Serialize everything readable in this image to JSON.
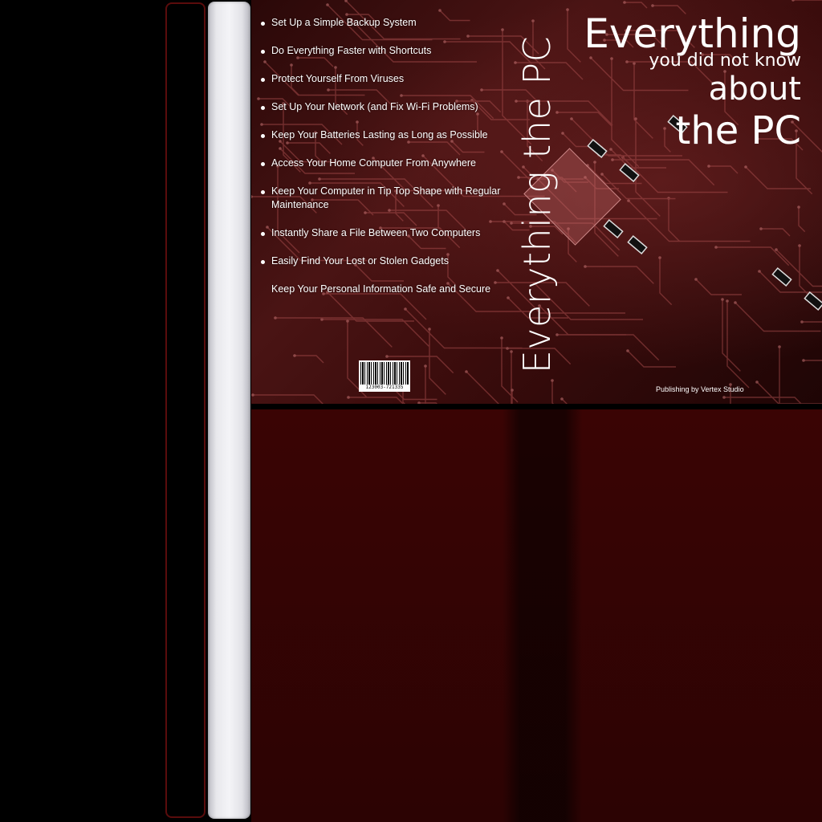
{
  "features": [
    {
      "text": "Set Up a Simple Backup System",
      "bullet": true
    },
    {
      "text": "Do Everything Faster with Shortcuts",
      "bullet": true
    },
    {
      "text": "Protect Yourself From Viruses",
      "bullet": true
    },
    {
      "text": "Set Up Your Network (and Fix Wi-Fi Problems)",
      "bullet": true
    },
    {
      "text": "Keep Your Batteries Lasting as Long as Possible",
      "bullet": true
    },
    {
      "text": "Access Your Home Computer From Anywhere",
      "bullet": true
    },
    {
      "text": "Keep Your Computer in Tip Top Shape with Regular Maintenance",
      "bullet": true
    },
    {
      "text": "Instantly Share a File Between Two Computers",
      "bullet": true
    },
    {
      "text": "Easily Find Your Lost or Stolen Gadgets",
      "bullet": true
    },
    {
      "text": "Keep Your Personal Information Safe and Secure",
      "bullet": false
    }
  ],
  "spine_title": "Everything the PC",
  "title": {
    "line1": "Everything",
    "line2": "you did not know",
    "line3": "about",
    "line4": "the PC"
  },
  "barcode_number": "123003-721335",
  "publisher": "Publishing by Vertex Studio",
  "colors": {
    "cover_red": "#4a1414",
    "bottom_red": "#3a0404",
    "spine_border": "#5a0c0c"
  }
}
